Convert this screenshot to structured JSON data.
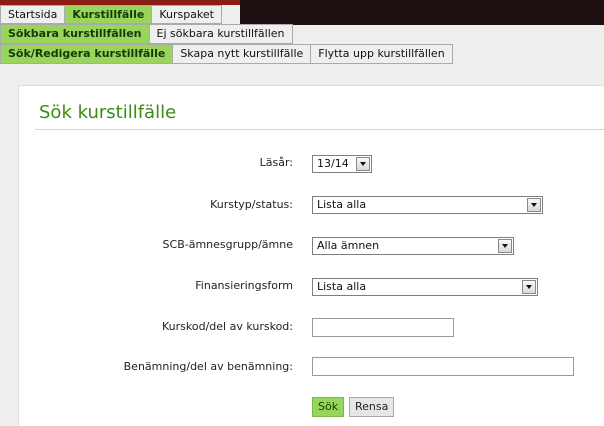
{
  "nav": {
    "level1": [
      {
        "label": "Startsida",
        "active": false
      },
      {
        "label": "Kurstillfälle",
        "active": true
      },
      {
        "label": "Kurspaket",
        "active": false
      }
    ],
    "level2": [
      {
        "label": "Sökbara kurstillfällen",
        "active": true
      },
      {
        "label": "Ej sökbara kurstillfällen",
        "active": false
      }
    ],
    "level3": [
      {
        "label": "Sök/Redigera kurstillfälle",
        "active": true
      },
      {
        "label": "Skapa nytt kurstillfälle",
        "active": false
      },
      {
        "label": "Flytta upp kurstillfällen",
        "active": false
      }
    ]
  },
  "form": {
    "title": "Sök kurstillfälle",
    "fields": {
      "lasar": {
        "label": "Läsår:",
        "value": "13/14"
      },
      "kurstyp": {
        "label": "Kurstyp/status:",
        "value": "Lista alla"
      },
      "scb": {
        "label": "SCB-ämnesgrupp/ämne",
        "value": "Alla ämnen"
      },
      "finansiering": {
        "label": "Finansieringsform",
        "value": "Lista alla"
      },
      "kurskod": {
        "label": "Kurskod/del av kurskod:",
        "value": ""
      },
      "benamning": {
        "label": "Benämning/del av benämning:",
        "value": ""
      }
    },
    "buttons": {
      "search": "Sök",
      "clear": "Rensa"
    }
  },
  "colors": {
    "accent": "#99d45c",
    "title": "#3d8a14",
    "header_red": "#8a1d16"
  }
}
